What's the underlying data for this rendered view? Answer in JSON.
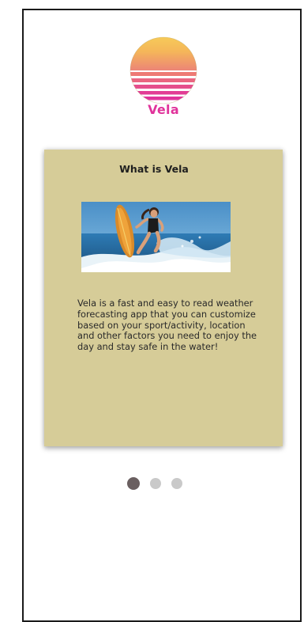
{
  "app": {
    "name": "Vela"
  },
  "card": {
    "title": "What is Vela",
    "description": "Vela is a fast and easy to read weather forecasting app that you can customize based on your sport/activity, location and other factors you need to enjoy the day and stay safe in the water!"
  },
  "pagination": {
    "total": 3,
    "active_index": 0
  },
  "colors": {
    "card_background": "#d6cc98",
    "brand_pink": "#e0339b",
    "sun_top": "#f6cd5a",
    "sun_bottom": "#e0339b",
    "dot_active": "#6a5f60",
    "dot_inactive": "#c9c9c9"
  },
  "icons": {
    "logo": "sunset-stripes-icon",
    "photo": "surfer-image"
  }
}
